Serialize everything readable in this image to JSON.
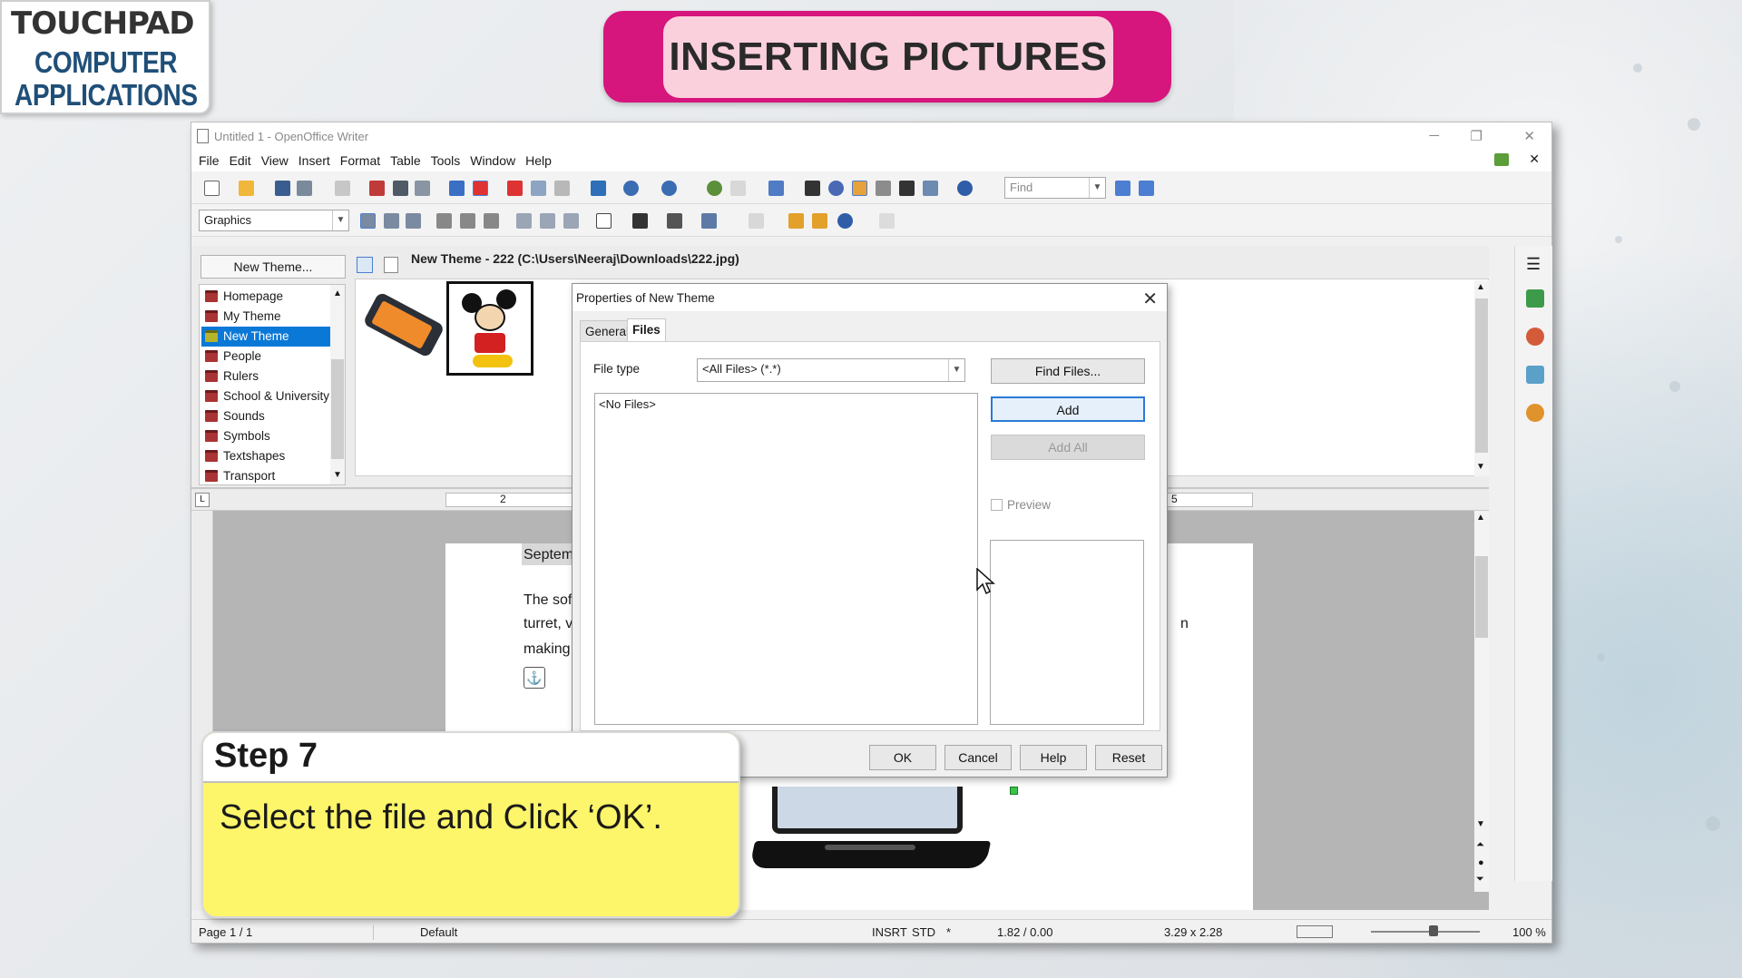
{
  "branding": {
    "logo_line1": "TOUCHPAD",
    "logo_line2": "COMPUTER",
    "logo_line3": "APPLICATIONS"
  },
  "banner": {
    "title": "INSERTING PICTURES"
  },
  "window": {
    "title": "Untitled 1 - OpenOffice Writer",
    "menu": [
      "File",
      "Edit",
      "View",
      "Insert",
      "Format",
      "Table",
      "Tools",
      "Window",
      "Help"
    ],
    "find_placeholder": "Find",
    "style_select": "Graphics"
  },
  "gallery": {
    "new_theme_button": "New Theme...",
    "path_label": "New Theme - 222 (C:\\Users\\Neeraj\\Downloads\\222.jpg)",
    "themes": [
      "Homepage",
      "My Theme",
      "New Theme",
      "People",
      "Rulers",
      "School & University",
      "Sounds",
      "Symbols",
      "Textshapes",
      "Transport"
    ],
    "active_theme": "New Theme"
  },
  "document": {
    "ruler_mark_2": "2",
    "ruler_mark_5": "5",
    "heading_fragment": "Septem",
    "text_line1": "The soft",
    "text_line2": "turret, v",
    "text_line3": "making.",
    "text_right": "n"
  },
  "dialog": {
    "title": "Properties of New Theme",
    "tabs": [
      "General",
      "Files"
    ],
    "active_tab": "Files",
    "file_type_label": "File type",
    "file_type_value": "<All Files> (*.*)",
    "file_list_empty": "<No Files>",
    "find_files_button": "Find Files...",
    "add_button": "Add",
    "add_all_button": "Add All",
    "preview_label": "Preview",
    "ok_button": "OK",
    "cancel_button": "Cancel",
    "help_button": "Help",
    "reset_button": "Reset"
  },
  "status": {
    "page": "Page 1 / 1",
    "style": "Default",
    "insert_mode": "INSRT",
    "selection_mode": "STD",
    "modified": "*",
    "position": "1.82 / 0.00",
    "size": "3.29 x 2.28",
    "zoom": "100 %"
  },
  "step": {
    "heading": "Step 7",
    "instruction": "Select the file and Click ‘OK’."
  },
  "colors": {
    "banner_outer": "#d6157d",
    "banner_inner": "#fbd0dd",
    "step_body": "#fdf56a",
    "selection": "#0a78d7"
  }
}
